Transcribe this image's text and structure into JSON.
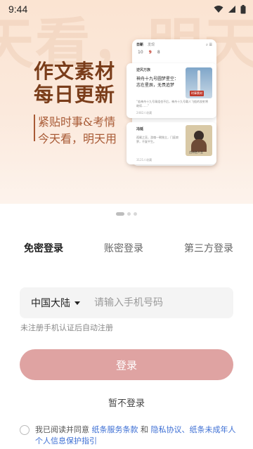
{
  "status_bar": {
    "time": "9:44"
  },
  "hero": {
    "watermark": "今天看，明天",
    "title_line1": "作文素材",
    "title_line2": "每日更新",
    "subtitle_line1": "紧贴时事&考情",
    "subtitle_line2": "今天看，明天用",
    "mockup": {
      "tab_active": "日新",
      "tab_other": "发现",
      "dates": [
        "10",
        "9",
        "8"
      ],
      "card1_tag": "逆风万族",
      "card1_title": "神舟十九号圆梦星空：志在星辰，无畏追梦",
      "card1_text": "“若神舟十九号乘组也不后，神舟十九号载人飞船的发射将继续……”",
      "card1_meta": "2482人收藏",
      "card1_badge": "时事素材",
      "card2_tag": "冯延",
      "card2_text": "孤雁之哀，游魂一朝独立，门庭寂寥，不复平生。",
      "card2_label": "古诗名人言",
      "card2_meta": "3121人收藏"
    }
  },
  "carousel": {
    "count": 3,
    "active_index": 0
  },
  "login_tabs": [
    {
      "label": "免密登录",
      "active": true
    },
    {
      "label": "账密登录",
      "active": false
    },
    {
      "label": "第三方登录",
      "active": false
    }
  ],
  "phone_input": {
    "region": "中国大陆",
    "placeholder": "请输入手机号码",
    "value": ""
  },
  "hint": "未注册手机认证后自动注册",
  "login_button": "登录",
  "skip_link": "暂不登录",
  "agreement": {
    "prefix": "我已阅读并同意 ",
    "link1": "纸条服务条款",
    "mid": " 和 ",
    "link2": "隐私协议、纸条未成年人个人信息保护指引"
  },
  "colors": {
    "accent_button": "#dfa3a2",
    "link": "#3d6fd4",
    "hero_bg": "#fbe4d2"
  }
}
